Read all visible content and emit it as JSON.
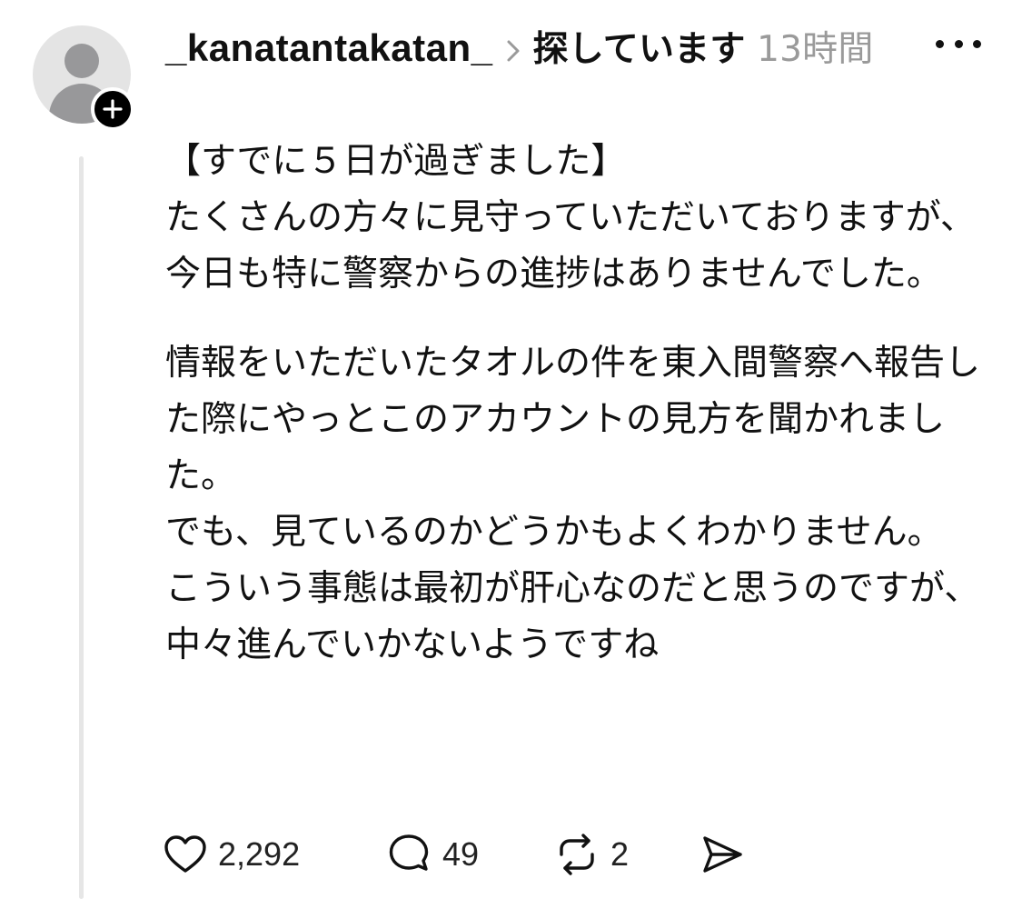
{
  "post": {
    "username": "_kanatantakatan_",
    "topic": "探しています",
    "time": "13時間",
    "body": {
      "p1_line1": "【すでに５日が過ぎました】",
      "p1_rest": "たくさんの方々に見守っていただいておりますが、今日も特に警察からの進捗はありませんでした。",
      "p2_a": "情報をいただいたタオルの件を東入間警察へ報告した際にやっとこのアカウントの見方を聞かれました。",
      "p2_b": "でも、見ているのかどうかもよくわかりません。",
      "p2_c": "こういう事態は最初が肝心なのだと思うのですが、中々進んでいかないようですね"
    },
    "actions": {
      "likes": "2,292",
      "replies": "49",
      "reposts": "2"
    }
  },
  "icons": {
    "avatar": "default-avatar-icon",
    "follow": "plus-icon",
    "chevron": "chevron-right-icon",
    "more": "more-horizontal-icon",
    "like": "heart-icon",
    "reply": "speech-bubble-icon",
    "repost": "repost-icon",
    "share": "send-icon"
  }
}
